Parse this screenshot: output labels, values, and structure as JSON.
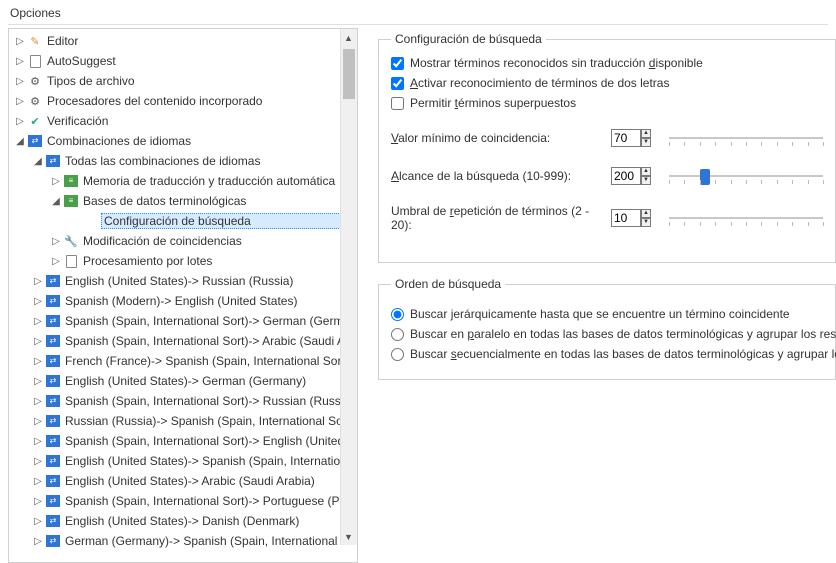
{
  "title": "Opciones",
  "tree": {
    "items": [
      {
        "indent": 0,
        "chev": "right",
        "icon": "pencil",
        "label": "Editor"
      },
      {
        "indent": 0,
        "chev": "right",
        "icon": "doc",
        "label": "AutoSuggest"
      },
      {
        "indent": 0,
        "chev": "right",
        "icon": "gears",
        "label": "Tipos de archivo"
      },
      {
        "indent": 0,
        "chev": "right",
        "icon": "gears",
        "label": "Procesadores del contenido incorporado"
      },
      {
        "indent": 0,
        "chev": "right",
        "icon": "check",
        "label": "Verificación"
      },
      {
        "indent": 0,
        "chev": "down",
        "icon": "blue",
        "label": "Combinaciones de idiomas"
      },
      {
        "indent": 1,
        "chev": "down",
        "icon": "blue",
        "label": "Todas las combinaciones de idiomas"
      },
      {
        "indent": 2,
        "chev": "right",
        "icon": "green",
        "label": "Memoria de traducción y traducción automática"
      },
      {
        "indent": 2,
        "chev": "down",
        "icon": "green",
        "label": "Bases de datos terminológicas"
      },
      {
        "indent": 3,
        "chev": "none",
        "icon": "none",
        "label": "Configuración de búsqueda",
        "selected": true
      },
      {
        "indent": 2,
        "chev": "right",
        "icon": "wrench",
        "label": "Modificación de coincidencias"
      },
      {
        "indent": 2,
        "chev": "right",
        "icon": "doc",
        "label": "Procesamiento por lotes"
      },
      {
        "indent": 1,
        "chev": "right",
        "icon": "blue",
        "label": "English (United States)-> Russian (Russia)"
      },
      {
        "indent": 1,
        "chev": "right",
        "icon": "blue",
        "label": "Spanish (Modern)-> English (United States)"
      },
      {
        "indent": 1,
        "chev": "right",
        "icon": "blue",
        "label": "Spanish (Spain, International Sort)-> German (Germany)"
      },
      {
        "indent": 1,
        "chev": "right",
        "icon": "blue",
        "label": "Spanish (Spain, International Sort)-> Arabic (Saudi Arabia)"
      },
      {
        "indent": 1,
        "chev": "right",
        "icon": "blue",
        "label": "French (France)-> Spanish (Spain, International Sort)"
      },
      {
        "indent": 1,
        "chev": "right",
        "icon": "blue",
        "label": "English (United States)-> German (Germany)"
      },
      {
        "indent": 1,
        "chev": "right",
        "icon": "blue",
        "label": "Spanish (Spain, International Sort)-> Russian (Russia)"
      },
      {
        "indent": 1,
        "chev": "right",
        "icon": "blue",
        "label": "Russian (Russia)-> Spanish (Spain, International Sort)"
      },
      {
        "indent": 1,
        "chev": "right",
        "icon": "blue",
        "label": "Spanish (Spain, International Sort)-> English (United States)"
      },
      {
        "indent": 1,
        "chev": "right",
        "icon": "blue",
        "label": "English (United States)-> Spanish (Spain, International Sort)"
      },
      {
        "indent": 1,
        "chev": "right",
        "icon": "blue",
        "label": "English (United States)-> Arabic (Saudi Arabia)"
      },
      {
        "indent": 1,
        "chev": "right",
        "icon": "blue",
        "label": "Spanish (Spain, International Sort)-> Portuguese (Portugal)"
      },
      {
        "indent": 1,
        "chev": "right",
        "icon": "blue",
        "label": "English (United States)-> Danish (Denmark)"
      },
      {
        "indent": 1,
        "chev": "right",
        "icon": "blue",
        "label": "German (Germany)-> Spanish (Spain, International Sort)"
      }
    ]
  },
  "settings": {
    "group1_title": "Configuración de búsqueda",
    "cb1": {
      "checked": true,
      "label_pre": "Mostrar términos reconocidos sin traducción ",
      "label_u": "d",
      "label_post": "isponible"
    },
    "cb2": {
      "checked": true,
      "label_u": "A",
      "label_post": "ctivar reconocimiento de términos de dos letras"
    },
    "cb3": {
      "checked": false,
      "label_pre": "Permitir ",
      "label_u": "t",
      "label_post": "érminos superpuestos"
    },
    "field1": {
      "label_u": "V",
      "label_post": "alor mínimo de coincidencia:",
      "value": "70"
    },
    "field2": {
      "label_u": "A",
      "label_post": "lcance de la búsqueda (10-999):",
      "value": "200",
      "thumb_pct": 20
    },
    "field3": {
      "label_pre": "Umbral de ",
      "label_u": "r",
      "label_post": "epetición de términos (2 - 20):",
      "value": "10"
    },
    "group2_title": "Orden de búsqueda",
    "radio1": {
      "checked": true,
      "label_pre": "Buscar ",
      "label_u": "j",
      "label_post": "erárquicamente hasta que se encuentre un término coincidente"
    },
    "radio2": {
      "checked": false,
      "label_pre": "Buscar en ",
      "label_u": "p",
      "label_post": "aralelo en todas las bases de datos terminológicas y agrupar los resultados"
    },
    "radio3": {
      "checked": false,
      "label_pre": "Buscar ",
      "label_u": "s",
      "label_post": "ecuencialmente en todas las bases de datos terminológicas y agrupar los resultados"
    }
  }
}
